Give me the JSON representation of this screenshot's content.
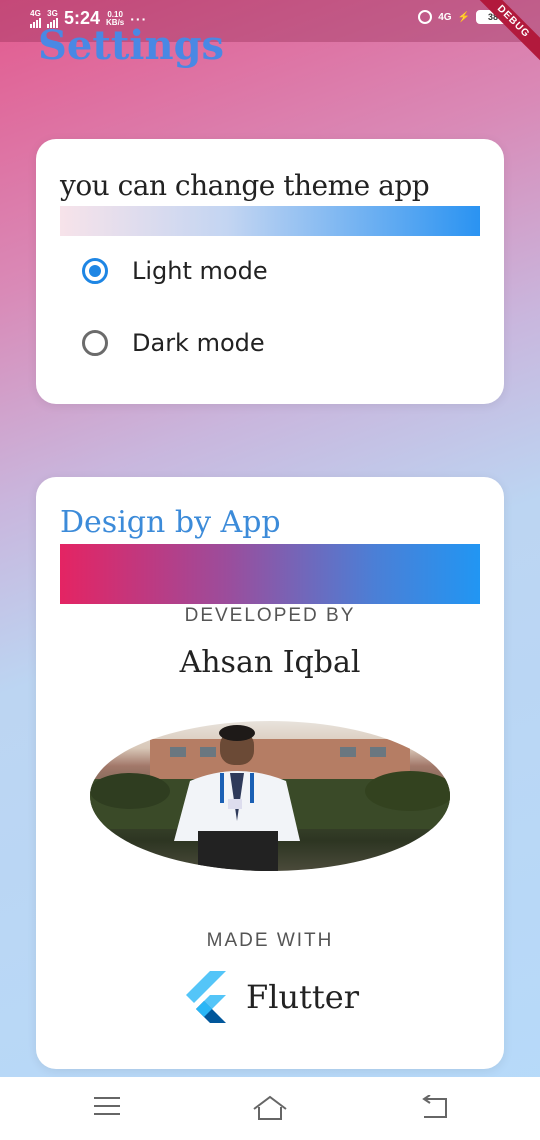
{
  "status_bar": {
    "network_1": "4G",
    "network_2": "3G",
    "time": "5:24",
    "speed_value": "0.10",
    "speed_unit": "KB/s",
    "overflow": "···",
    "network_right": "4G",
    "battery": "38",
    "debug_banner": "DEBUG"
  },
  "page": {
    "title": "Settings"
  },
  "theme_card": {
    "heading": "you can change theme app",
    "options": [
      {
        "label": "Light mode",
        "selected": true
      },
      {
        "label": "Dark mode",
        "selected": false
      }
    ],
    "accent_color": "#1e86e4"
  },
  "about_card": {
    "heading": "Design by App",
    "developed_by_label": "DEVELOPED BY",
    "developer_name": "Ahsan Iqbal",
    "made_with_label": "MADE WITH",
    "framework_name": "Flutter"
  },
  "nav_bar": {
    "items": [
      "menu-icon",
      "home-icon",
      "back-icon"
    ]
  },
  "colors": {
    "title": "#4a88e4",
    "heading_blue": "#3c8bd9",
    "gradient_pink": "#e42463",
    "gradient_blue": "#2196f3"
  }
}
